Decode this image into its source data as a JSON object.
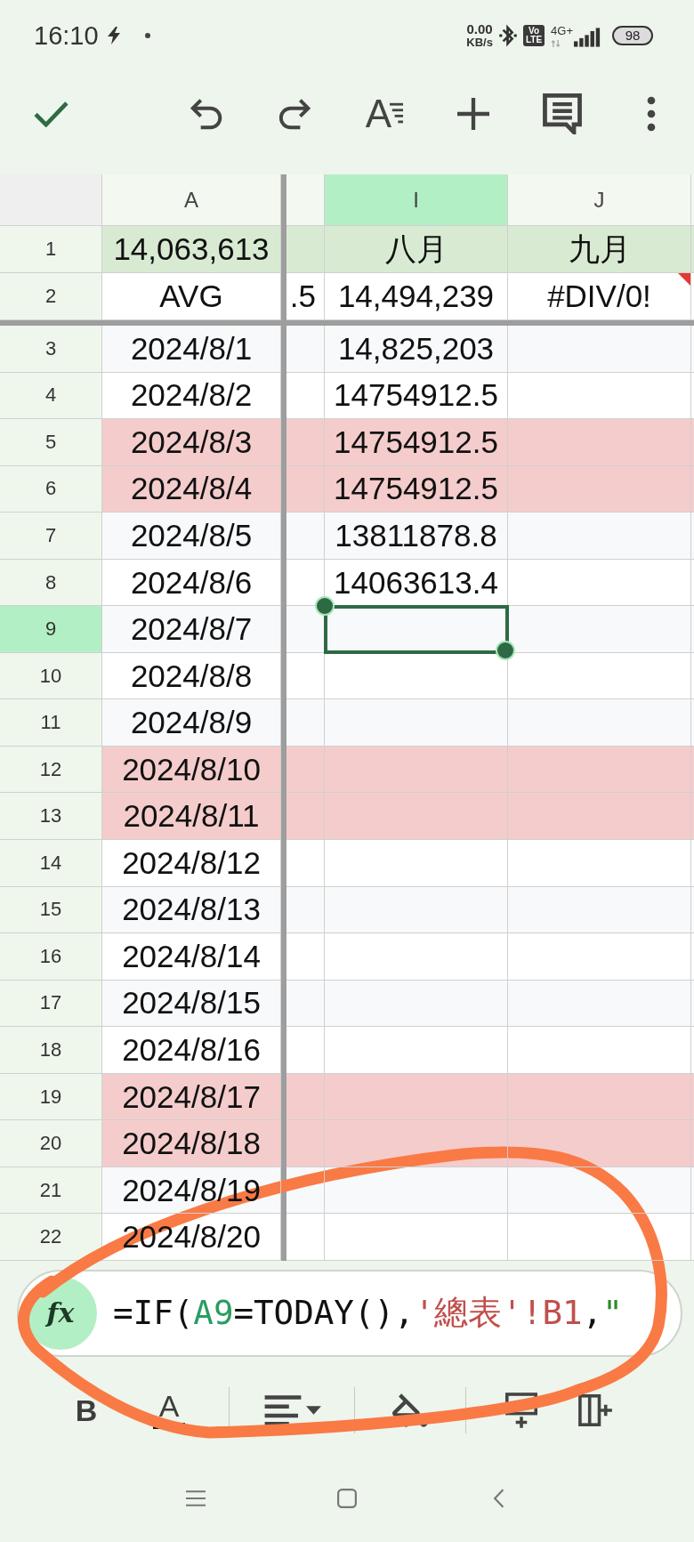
{
  "status_bar": {
    "time": "16:10",
    "net_speed": "0.00",
    "net_speed_unit": "KB/s",
    "volte": [
      "Vo",
      "LTE"
    ],
    "network_type": "4G+",
    "battery": "98"
  },
  "toolbar": [
    {
      "kind": "confirm"
    },
    {
      "kind": "undo"
    },
    {
      "kind": "redo"
    },
    {
      "kind": "text_format",
      "label": "A"
    },
    {
      "kind": "insert"
    },
    {
      "kind": "comment"
    },
    {
      "kind": "more"
    }
  ],
  "sheet": {
    "frozen_columns": [
      {
        "label": "A",
        "selected": false
      }
    ],
    "columns": [
      {
        "kind": "partial",
        "selected": false
      },
      {
        "kind": "full",
        "label": "I",
        "selected": true
      },
      {
        "kind": "full",
        "label": "J",
        "selected": false
      },
      {
        "kind": "partial",
        "selected": false
      }
    ],
    "frozen_rows": [
      {
        "number": "1",
        "selected": false,
        "color": "#d9ead3",
        "corner_mark": false,
        "cells": [
          "14,063,613",
          null,
          "八月",
          "九月",
          null
        ]
      },
      {
        "number": "2",
        "selected": false,
        "color": "#ffffff",
        "corner_mark": true,
        "cells": [
          "AVG",
          ".5",
          "14,494,239",
          "#DIV/0!",
          null
        ]
      }
    ],
    "rows": [
      {
        "number": "3",
        "selected": false,
        "color": "#f8f9fb",
        "corner_mark": false,
        "cells": [
          "2024/8/1",
          null,
          "14,825,203",
          null,
          null
        ]
      },
      {
        "number": "4",
        "selected": false,
        "color": "#ffffff",
        "corner_mark": false,
        "cells": [
          "2024/8/2",
          null,
          "14754912.5",
          null,
          null
        ]
      },
      {
        "number": "5",
        "selected": false,
        "color": "#f4cccc",
        "corner_mark": false,
        "cells": [
          "2024/8/3",
          null,
          "14754912.5",
          null,
          null
        ]
      },
      {
        "number": "6",
        "selected": false,
        "color": "#f4cccc",
        "corner_mark": false,
        "cells": [
          "2024/8/4",
          null,
          "14754912.5",
          null,
          null
        ]
      },
      {
        "number": "7",
        "selected": false,
        "color": "#f8f9fb",
        "corner_mark": false,
        "cells": [
          "2024/8/5",
          null,
          "13811878.8",
          null,
          null
        ]
      },
      {
        "number": "8",
        "selected": false,
        "color": "#ffffff",
        "corner_mark": false,
        "cells": [
          "2024/8/6",
          null,
          "14063613.4",
          null,
          null
        ]
      },
      {
        "number": "9",
        "selected": true,
        "color": "#f8f9fb",
        "corner_mark": false,
        "cells": [
          "2024/8/7",
          null,
          null,
          null,
          null
        ]
      },
      {
        "number": "10",
        "selected": false,
        "color": "#ffffff",
        "corner_mark": false,
        "cells": [
          "2024/8/8",
          null,
          null,
          null,
          null
        ]
      },
      {
        "number": "11",
        "selected": false,
        "color": "#f8f9fb",
        "corner_mark": false,
        "cells": [
          "2024/8/9",
          null,
          null,
          null,
          null
        ]
      },
      {
        "number": "12",
        "selected": false,
        "color": "#f4cccc",
        "corner_mark": false,
        "cells": [
          "2024/8/10",
          null,
          null,
          null,
          null
        ]
      },
      {
        "number": "13",
        "selected": false,
        "color": "#f4cccc",
        "corner_mark": false,
        "cells": [
          "2024/8/11",
          null,
          null,
          null,
          null
        ]
      },
      {
        "number": "14",
        "selected": false,
        "color": "#ffffff",
        "corner_mark": false,
        "cells": [
          "2024/8/12",
          null,
          null,
          null,
          null
        ]
      },
      {
        "number": "15",
        "selected": false,
        "color": "#f8f9fb",
        "corner_mark": false,
        "cells": [
          "2024/8/13",
          null,
          null,
          null,
          null
        ]
      },
      {
        "number": "16",
        "selected": false,
        "color": "#ffffff",
        "corner_mark": false,
        "cells": [
          "2024/8/14",
          null,
          null,
          null,
          null
        ]
      },
      {
        "number": "17",
        "selected": false,
        "color": "#f8f9fb",
        "corner_mark": false,
        "cells": [
          "2024/8/15",
          null,
          null,
          null,
          null
        ]
      },
      {
        "number": "18",
        "selected": false,
        "color": "#ffffff",
        "corner_mark": false,
        "cells": [
          "2024/8/16",
          null,
          null,
          null,
          null
        ]
      },
      {
        "number": "19",
        "selected": false,
        "color": "#f4cccc",
        "corner_mark": false,
        "cells": [
          "2024/8/17",
          null,
          null,
          null,
          null
        ]
      },
      {
        "number": "20",
        "selected": false,
        "color": "#f4cccc",
        "corner_mark": false,
        "cells": [
          "2024/8/18",
          null,
          null,
          null,
          null
        ]
      },
      {
        "number": "21",
        "selected": false,
        "color": "#f8f9fb",
        "corner_mark": false,
        "cells": [
          "2024/8/19",
          null,
          null,
          null,
          null
        ]
      },
      {
        "number": "22",
        "selected": false,
        "color": "#ffffff",
        "corner_mark": false,
        "cells": [
          "2024/8/20",
          null,
          null,
          null,
          null
        ]
      }
    ]
  },
  "formula_bar": {
    "button_label": "fx",
    "formula": [
      {
        "kind": "text",
        "text": "=IF("
      },
      {
        "kind": "cell_ref",
        "text": "A9"
      },
      {
        "kind": "text",
        "text": "=TODAY(),"
      },
      {
        "kind": "sheet_ref",
        "text": "'總表'!B1"
      },
      {
        "kind": "text",
        "text": ","
      },
      {
        "kind": "string",
        "text": "\""
      }
    ]
  },
  "format_bar": [
    [
      {
        "kind": "bold",
        "label": "B"
      },
      {
        "kind": "text_color",
        "label": "A"
      }
    ],
    [
      {
        "kind": "align"
      }
    ],
    [
      {
        "kind": "fill"
      }
    ],
    [
      {
        "kind": "insert_row"
      },
      {
        "kind": "insert_column"
      }
    ]
  ]
}
